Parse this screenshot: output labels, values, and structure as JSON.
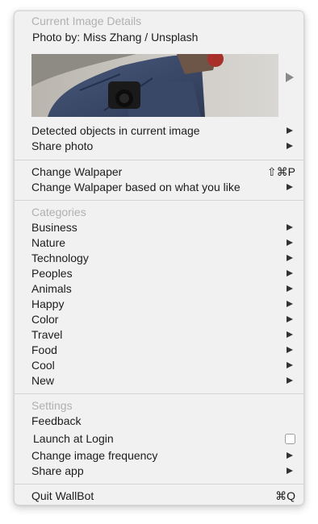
{
  "current_image": {
    "header": "Current Image Details",
    "credit": "Photo by: Miss Zhang / Unsplash"
  },
  "image_actions": {
    "detected_objects": "Detected objects in current image",
    "share_photo": "Share photo"
  },
  "wallpaper": {
    "change": "Change Walpaper",
    "change_shortcut": "⇧⌘P",
    "change_based": "Change Walpaper based on what you like"
  },
  "categories": {
    "header": "Categories",
    "items": [
      "Business",
      "Nature",
      "Technology",
      "Peoples",
      "Animals",
      "Happy",
      "Color",
      "Travel",
      "Food",
      "Cool",
      "New"
    ]
  },
  "settings": {
    "header": "Settings",
    "feedback": "Feedback",
    "launch_at_login": "Launch at Login",
    "launch_at_login_checked": false,
    "change_frequency": "Change image frequency",
    "share_app": "Share app"
  },
  "quit": {
    "label": "Quit WallBot",
    "shortcut": "⌘Q"
  },
  "icons": {
    "submenu": "chevron-right-icon",
    "image_expand": "chevron-right-icon"
  },
  "colors": {
    "menu_background": "#f1f1f1",
    "header_text": "#b0b0b0",
    "text": "#1c1c1c",
    "separator": "#d4d4d4"
  }
}
